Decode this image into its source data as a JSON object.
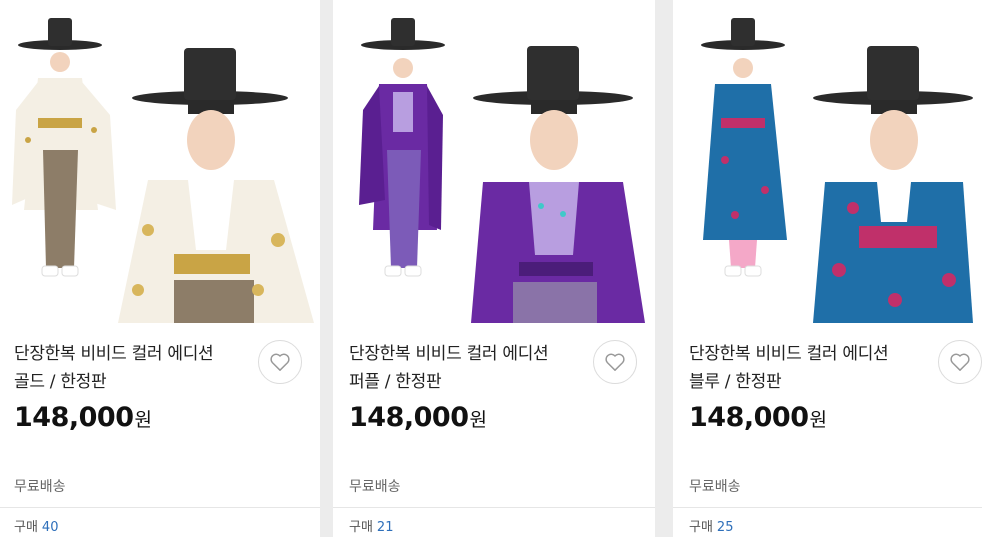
{
  "products": [
    {
      "title_line1": "단장한복 비비드 컬러 에디션",
      "title_line2": "골드 / 한정판",
      "price": "148,000",
      "currency": "원",
      "shipping": "무료배송",
      "purchase_label": "구매",
      "purchase_count": "40",
      "image_icon": "doll-gold-hanbok-image",
      "robe_color": "#f4efe4",
      "accent_color": "#c9a445"
    },
    {
      "title_line1": "단장한복 비비드 컬러 에디션",
      "title_line2": "퍼플 / 한정판",
      "price": "148,000",
      "currency": "원",
      "shipping": "무료배송",
      "purchase_label": "구매",
      "purchase_count": "21",
      "image_icon": "doll-purple-hanbok-image",
      "robe_color": "#6a2aa3",
      "accent_color": "#b89ee0"
    },
    {
      "title_line1": "단장한복 비비드 컬러 에디션",
      "title_line2": "블루 / 한정판",
      "price": "148,000",
      "currency": "원",
      "shipping": "무료배송",
      "purchase_label": "구매",
      "purchase_count": "25",
      "image_icon": "doll-blue-hanbok-image",
      "robe_color": "#1f6fa8",
      "accent_color": "#c0306a"
    }
  ],
  "icons": {
    "wishlist": "heart-icon"
  },
  "colors": {
    "price_text": "#111111",
    "count_text": "#2e6fba",
    "page_bg": "#ececec"
  }
}
